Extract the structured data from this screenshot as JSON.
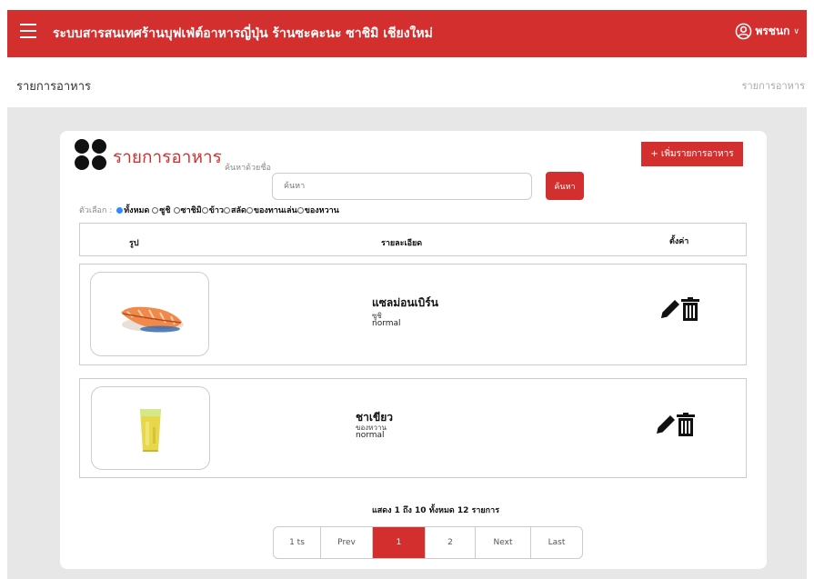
{
  "header": {
    "title": "ระบบสารสนเทศร้านบุฟเฟ่ต์อาหารญี่ปุ่น ร้านซะคะนะ ซาชิมิ เชียงใหม่",
    "user": "พรชนก",
    "caret": "∨",
    "brand_color": "#d32f2f"
  },
  "page": {
    "heading": "รายการอาหาร",
    "breadcrumb": "รายการอาหาร"
  },
  "card": {
    "title": "รายการอาหาร",
    "search_label": "ค้นหาด้วยชื่อ",
    "search_placeholder": "ค้นหา",
    "search_button": "ค้นหา",
    "add_button": "+ เพิ่มรายการอาหาร"
  },
  "filters": {
    "label": "ตัวเลือก :",
    "options": [
      {
        "label": "ทั้งหมด",
        "selected": true
      },
      {
        "label": "ซูชิ",
        "selected": false
      },
      {
        "label": "ซาชิมิ",
        "selected": false
      },
      {
        "label": "ข้าว",
        "selected": false
      },
      {
        "label": "สลัด",
        "selected": false
      },
      {
        "label": "ของทานเล่น",
        "selected": false
      },
      {
        "label": "ของหวาน",
        "selected": false
      }
    ]
  },
  "table": {
    "columns": [
      "รูป",
      "รายละเอียด",
      "ตั้งค่า"
    ]
  },
  "items": [
    {
      "name": "แซลม่อนเบิร์น",
      "category": "ซูชิ",
      "status": "normal",
      "image_icon": "salmon-sushi-image"
    },
    {
      "name": "ชาเขียว",
      "category": "ของหวาน",
      "status": "normal",
      "image_icon": "green-tea-image"
    }
  ],
  "summary": "แสดง 1 ถึง 10 ทั้งหมด 12 รายการ",
  "pagination": {
    "items": [
      {
        "label": "1 ts",
        "active": false
      },
      {
        "label": "Prev",
        "active": false
      },
      {
        "label": "1",
        "active": true
      },
      {
        "label": "2",
        "active": false
      },
      {
        "label": "Next",
        "active": false
      },
      {
        "label": "Last",
        "active": false
      }
    ]
  }
}
